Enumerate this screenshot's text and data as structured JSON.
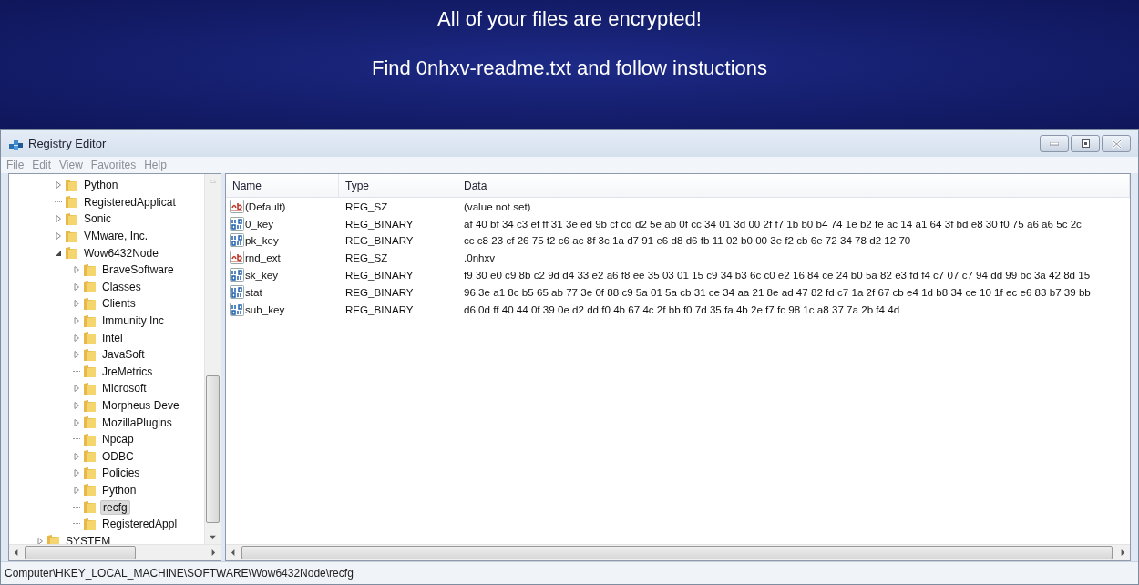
{
  "banner": {
    "lines": [
      "All of your files are encrypted!",
      "Find 0nhxv-readme.txt and follow instuctions"
    ]
  },
  "window": {
    "title": "Registry Editor"
  },
  "menu": [
    "File",
    "Edit",
    "View",
    "Favorites",
    "Help"
  ],
  "tree": [
    {
      "children": [
        {
          "label": "Python",
          "expanded": false,
          "selected": false
        },
        {
          "label": "RegisteredApplicat",
          "selected": false
        },
        {
          "label": "Sonic",
          "expanded": false,
          "selected": false
        },
        {
          "label": "VMware, Inc.",
          "expanded": false,
          "selected": false
        },
        {
          "label": "Wow6432Node",
          "expanded": true,
          "selected": false,
          "children": [
            {
              "label": "BraveSoftware",
              "expanded": false,
              "selected": false
            },
            {
              "label": "Classes",
              "expanded": false,
              "selected": false
            },
            {
              "label": "Clients",
              "expanded": false,
              "selected": false
            },
            {
              "label": "Immunity Inc",
              "expanded": false,
              "selected": false
            },
            {
              "label": "Intel",
              "expanded": false,
              "selected": false
            },
            {
              "label": "JavaSoft",
              "expanded": false,
              "selected": false
            },
            {
              "label": "JreMetrics",
              "selected": false
            },
            {
              "label": "Microsoft",
              "expanded": false,
              "selected": false
            },
            {
              "label": "Morpheus Deve",
              "expanded": false,
              "selected": false
            },
            {
              "label": "MozillaPlugins",
              "expanded": false,
              "selected": false
            },
            {
              "label": "Npcap",
              "selected": false
            },
            {
              "label": "ODBC",
              "expanded": false,
              "selected": false
            },
            {
              "label": "Policies",
              "expanded": false,
              "selected": false
            },
            {
              "label": "Python",
              "expanded": false,
              "selected": false
            },
            {
              "label": "recfg",
              "selected": true
            },
            {
              "label": "RegisteredAppl",
              "selected": false
            }
          ]
        }
      ]
    },
    {
      "label": "SYSTEM",
      "expanded": false,
      "selected": false
    }
  ],
  "values": {
    "columns": [
      "Name",
      "Type",
      "Data"
    ],
    "rows": [
      {
        "kind": "string",
        "name": "(Default)",
        "type": "REG_SZ",
        "data": "(value not set)"
      },
      {
        "kind": "binary",
        "name": "0_key",
        "type": "REG_BINARY",
        "data": "af 40 bf 34 c3 ef ff 31 3e ed 9b cf cd d2 5e ab 0f cc 34 01 3d 00 2f f7 1b b0 b4 74 1e b2 fe ac 14 a1 64 3f bd e8 30 f0 75 a6 a6 5c 2c"
      },
      {
        "kind": "binary",
        "name": "pk_key",
        "type": "REG_BINARY",
        "data": "cc c8 23 cf 26 75 f2 c6 ac 8f 3c 1a d7 91 e6 d8 d6 fb 11 02 b0 00 3e f2 cb 6e 72 34 78 d2 12 70"
      },
      {
        "kind": "string",
        "name": "rnd_ext",
        "type": "REG_SZ",
        "data": ".0nhxv"
      },
      {
        "kind": "binary",
        "name": "sk_key",
        "type": "REG_BINARY",
        "data": "f9 30 e0 c9 8b c2 9d d4 33 e2 a6 f8 ee 35 03 01 15 c9 34 b3 6c c0 e2 16 84 ce 24 b0 5a 82 e3 fd f4 c7 07 c7 94 dd 99 bc 3a 42 8d 15"
      },
      {
        "kind": "binary",
        "name": "stat",
        "type": "REG_BINARY",
        "data": "96 3e a1 8c b5 65 ab 77 3e 0f 88 c9 5a 01 5a cb 31 ce 34 aa 21 8e ad 47 82 fd c7 1a 2f 67 cb e4 1d b8 34 ce 10 1f ec e6 83 b7 39 bb"
      },
      {
        "kind": "binary",
        "name": "sub_key",
        "type": "REG_BINARY",
        "data": "d6 0d ff 40 44 0f 39 0e d2 dd f0 4b 67 4c 2f bb f0 7d 35 fa 4b 2e f7 fc 98 1c a8 37 7a 2b f4 4d"
      }
    ]
  },
  "status_bar": "Computer\\HKEY_LOCAL_MACHINE\\SOFTWARE\\Wow6432Node\\recfg"
}
